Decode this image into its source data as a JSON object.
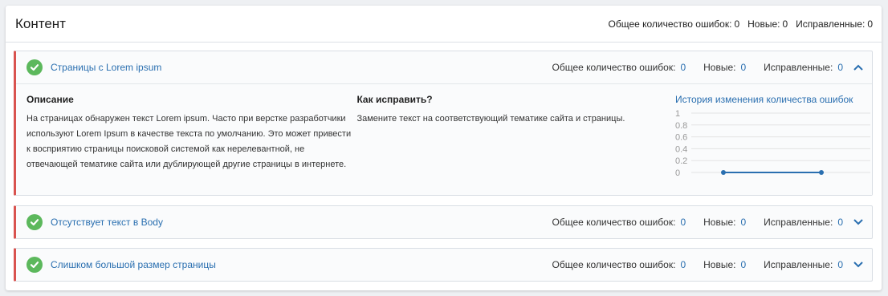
{
  "header": {
    "title": "Контент",
    "total_label": "Общее количество ошибок:",
    "total_value": "0",
    "new_label": "Новые:",
    "new_value": "0",
    "fixed_label": "Исправленные:",
    "fixed_value": "0"
  },
  "issues": [
    {
      "title": "Страницы с Lorem ipsum",
      "total_label": "Общее количество ошибок:",
      "total_value": "0",
      "new_label": "Новые:",
      "new_value": "0",
      "fixed_label": "Исправленные:",
      "fixed_value": "0",
      "expanded": true,
      "description_heading": "Описание",
      "description": "На страницах обнаружен текст Lorem ipsum. Часто при верстке разработчики используют Lorem Ipsum в качестве текста по умолчанию. Это может привести к восприятию страницы поисковой системой как нерелевантной, не отвечающей тематике сайта или дублирующей другие страницы в интернете.",
      "fix_heading": "Как исправить?",
      "fix_text": "Замените текст на соответствующий тематике сайта и страницы.",
      "history_heading": "История изменения количества ошибок"
    },
    {
      "title": "Отсутствует текст в Body",
      "total_label": "Общее количество ошибок:",
      "total_value": "0",
      "new_label": "Новые:",
      "new_value": "0",
      "fixed_label": "Исправленные:",
      "fixed_value": "0",
      "expanded": false
    },
    {
      "title": "Слишком большой размер страницы",
      "total_label": "Общее количество ошибок:",
      "total_value": "0",
      "new_label": "Новые:",
      "new_value": "0",
      "fixed_label": "Исправленные:",
      "fixed_value": "0",
      "expanded": false
    }
  ],
  "chart_data": {
    "type": "line",
    "x": [
      1,
      2
    ],
    "values": [
      0,
      0
    ],
    "ylim": [
      0,
      1
    ],
    "yticks": [
      "1",
      "0.8",
      "0.6",
      "0.4",
      "0.2",
      "0"
    ],
    "grid": true
  },
  "colors": {
    "accent": "#2a6fb0",
    "error_border": "#d9534f",
    "success": "#5cb85c",
    "line": "#2a6fb0"
  }
}
